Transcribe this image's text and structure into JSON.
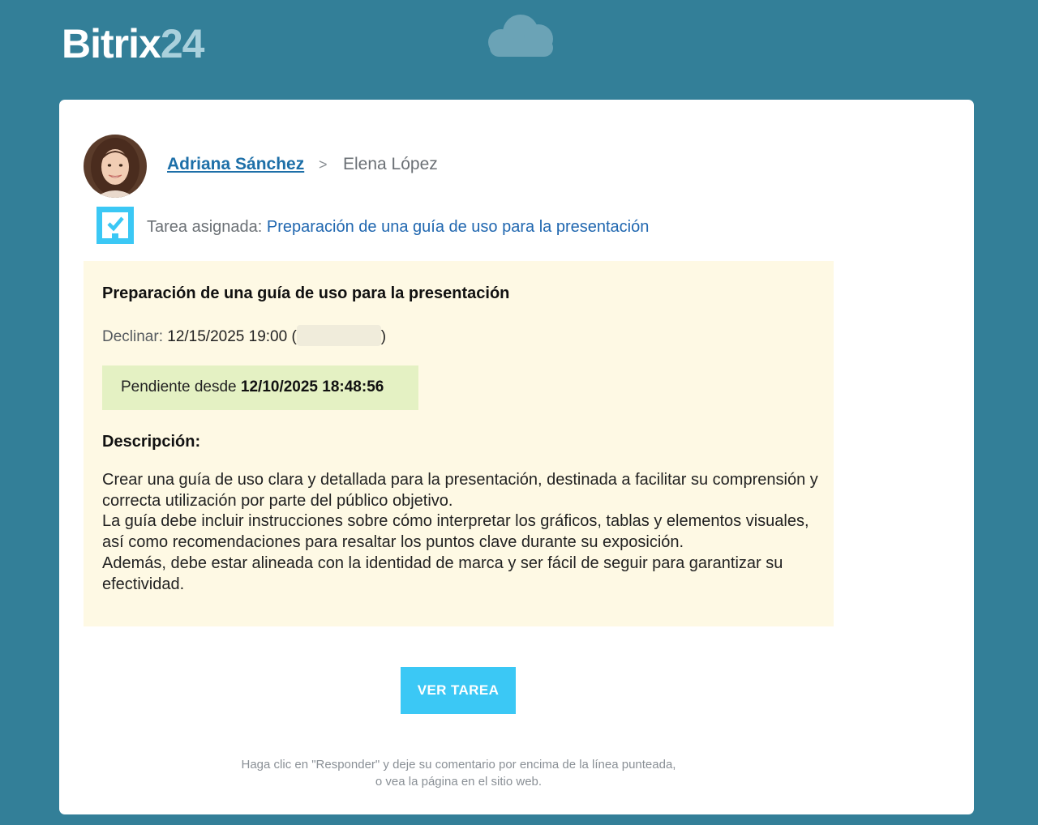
{
  "brand": {
    "logo_text": "Bitrix",
    "logo_number": "24",
    "icon": "cloud-icon"
  },
  "email": {
    "sender": "Adriana Sánchez",
    "arrow": ">",
    "recipient": "Elena López",
    "avatar_icon": "avatar-photo",
    "task_icon": "checkbox-icon",
    "assigned_label": "Tarea asignada:",
    "assigned_task": "Preparación de una guía de uso para la presentación"
  },
  "task": {
    "title": "Preparación de una guía de uso para la presentación",
    "deadline_label": "Declinar:",
    "deadline_value": "12/15/2025 19:00",
    "pending_label": "Pendiente desde",
    "pending_value": "12/10/2025 18:48:56",
    "description_label": "Descripción:",
    "description_lines": [
      "Crear una guía de uso clara y detallada para la presentación, destinada a facilitar su comprensión y correcta utilización por parte del público objetivo.",
      "La guía debe incluir instrucciones sobre cómo interpretar los gráficos, tablas y elementos visuales, así como recomendaciones para resaltar los puntos clave durante su exposición.",
      "Además, debe estar alineada con la identidad de marca y ser fácil de seguir para garantizar su efectividad."
    ]
  },
  "actions": {
    "view_task": "VER TAREA"
  },
  "footer": {
    "line1": "Haga clic en \"Responder\" y deje su comentario por encima de la línea punteada,",
    "line2": "o vea la página en el sitio web."
  },
  "colors": {
    "background": "#337f98",
    "card": "#ffffff",
    "panel": "#fef9e4",
    "status": "#e4f1c3",
    "button": "#3bc8f5",
    "link": "#2067b0"
  }
}
